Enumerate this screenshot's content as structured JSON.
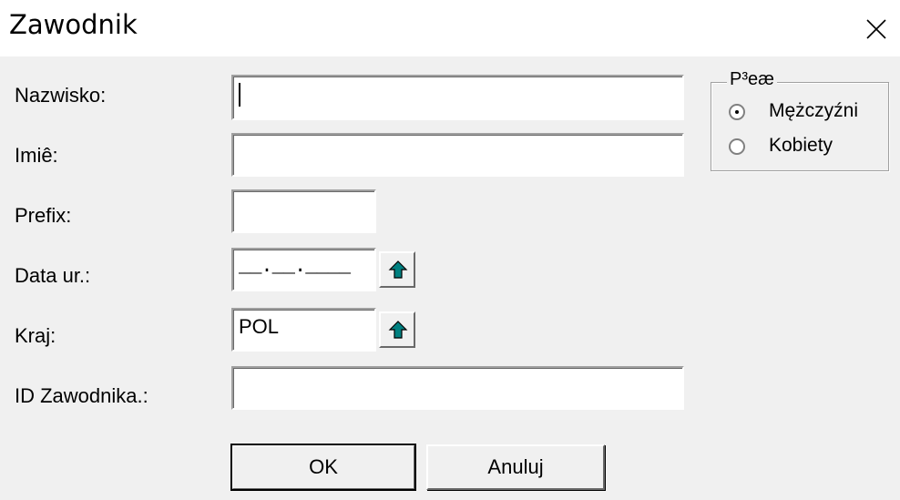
{
  "window": {
    "title": "Zawodnik",
    "close_glyph": "✕"
  },
  "form": {
    "surname_label": "Nazwisko:",
    "firstname_label": "Imiê:",
    "prefix_label": "Prefix:",
    "birthdate_label": "Data ur.:",
    "country_label": "Kraj:",
    "id_label": "ID Zawodnika.:",
    "surname_value": "",
    "firstname_value": "",
    "prefix_value": "",
    "birthdate_value": "__.__.____",
    "country_value": "POL",
    "id_value": ""
  },
  "gender": {
    "legend": "P³eæ",
    "options": [
      {
        "label": "Mężczyźni",
        "selected": true
      },
      {
        "label": "Kobiety",
        "selected": false
      }
    ]
  },
  "buttons": {
    "ok": "OK",
    "cancel": "Anuluj"
  },
  "colors": {
    "arrow": "#008080",
    "face": "#f0f0f0"
  },
  "icons": {
    "close": "close-icon",
    "up_arrow": "up-arrow-icon"
  }
}
